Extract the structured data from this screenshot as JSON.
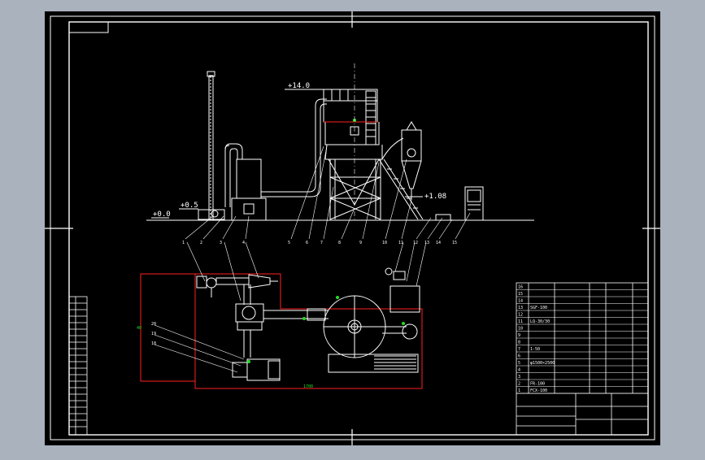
{
  "window": {
    "background_color": "#a9b2bd",
    "canvas_color": "#000000",
    "line_color": "#ffffff",
    "highlight_red": "#ff2020",
    "highlight_green": "#22dd22"
  },
  "elevation": {
    "levels": {
      "top": "+14.0",
      "cyclone": "+1.08",
      "low": "+0.5",
      "ground": "+0.0"
    },
    "callouts": [
      "1",
      "2",
      "3",
      "4",
      "5",
      "6",
      "7",
      "8",
      "9",
      "10",
      "11",
      "12",
      "13",
      "14",
      "15",
      "16",
      "17",
      "18"
    ]
  },
  "plan": {
    "callouts_top": [
      "4",
      "5",
      "6",
      "13",
      "14",
      "15"
    ],
    "callouts_side": [
      "20",
      "19",
      "18"
    ],
    "dim_bottom": "1700",
    "dim_left": "40"
  },
  "title_block": {
    "rows": [
      "16",
      "15",
      "14",
      "13",
      "12",
      "11",
      "10",
      "9",
      "8",
      "7",
      "6",
      "5",
      "4",
      "3",
      "2",
      "1"
    ],
    "parts": [
      "",
      "",
      "",
      "SGF-100",
      "",
      "LQ-30/30",
      "",
      "",
      "",
      "1-50",
      "",
      "φ1500×2500",
      "",
      "",
      "FR-100",
      "FCX-100"
    ]
  },
  "left_table": {
    "rows": 20
  }
}
